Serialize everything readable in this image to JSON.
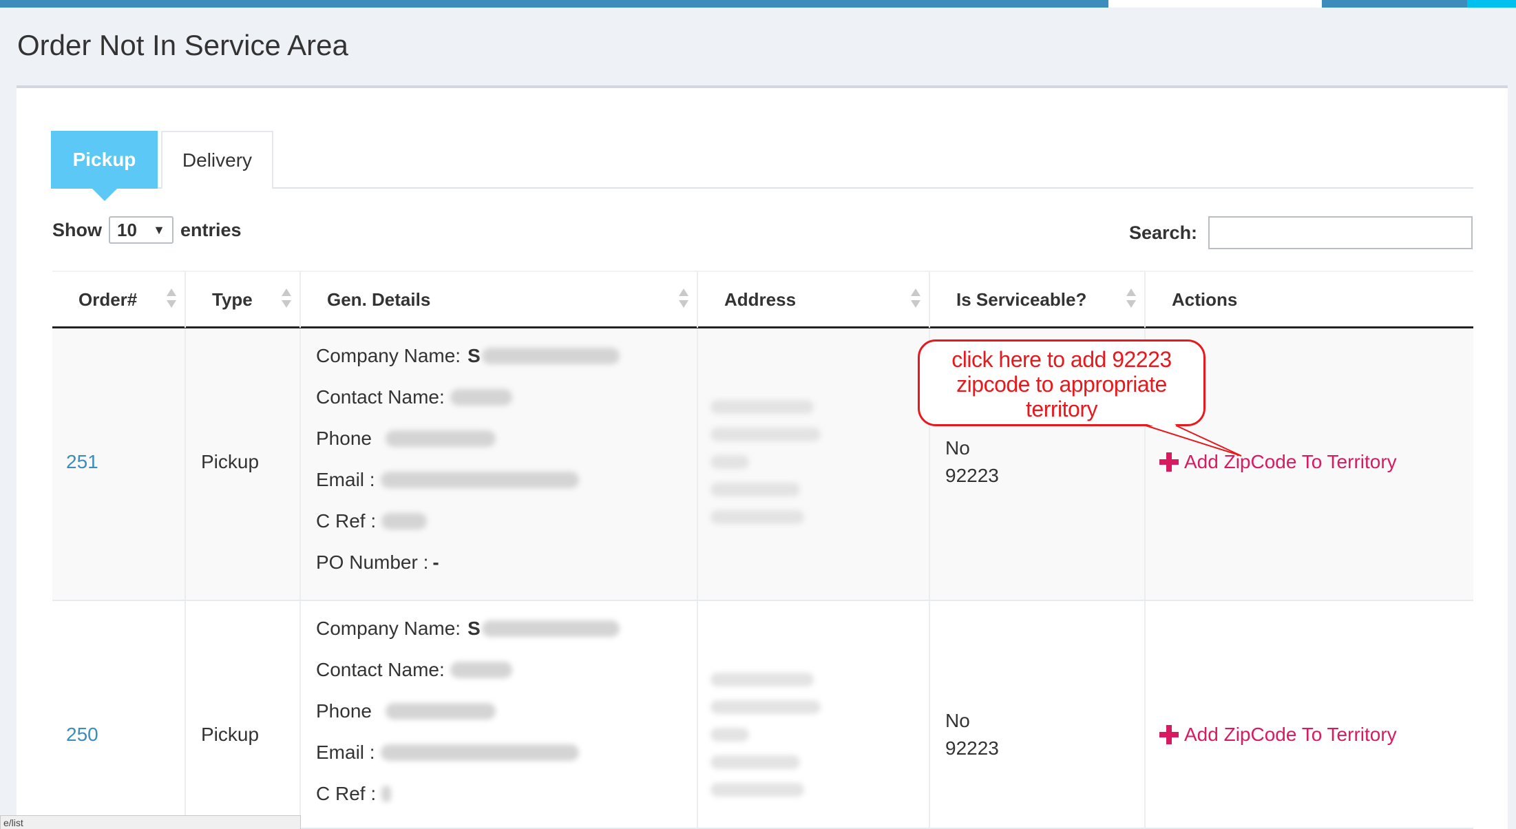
{
  "page": {
    "title": "Order Not In Service Area"
  },
  "tabs": [
    {
      "label": "Pickup",
      "active": true
    },
    {
      "label": "Delivery",
      "active": false
    }
  ],
  "length_control": {
    "show_label": "Show",
    "value": "10",
    "entries_label": "entries"
  },
  "search": {
    "label": "Search:",
    "value": ""
  },
  "table": {
    "columns": [
      "Order#",
      "Type",
      "Gen. Details",
      "Address",
      "Is Serviceable?",
      "Actions"
    ],
    "field_labels": {
      "company": "Company Name:",
      "contact": "Contact Name:",
      "phone": "Phone",
      "email": "Email :",
      "cref": "C Ref :",
      "po": "PO Number :"
    },
    "rows": [
      {
        "order": "251",
        "type": "Pickup",
        "company_initial": "S",
        "po_value": "-",
        "serviceable": "No",
        "zipcode": "92223",
        "action": "Add ZipCode To Territory"
      },
      {
        "order": "250",
        "type": "Pickup",
        "company_initial": "S",
        "serviceable": "No",
        "zipcode": "92223",
        "action": "Add ZipCode To Territory"
      }
    ]
  },
  "annotation": {
    "line1": "click here to add 92223",
    "line2": "zipcode to appropriate",
    "line3": "territory"
  },
  "statusbar": {
    "url": "e/list"
  },
  "colors": {
    "navbar": "#3c8dbc",
    "tab_active": "#5bc8f5",
    "link": "#3c8dbc",
    "action": "#d81b60",
    "annotation": "#e8181c"
  }
}
